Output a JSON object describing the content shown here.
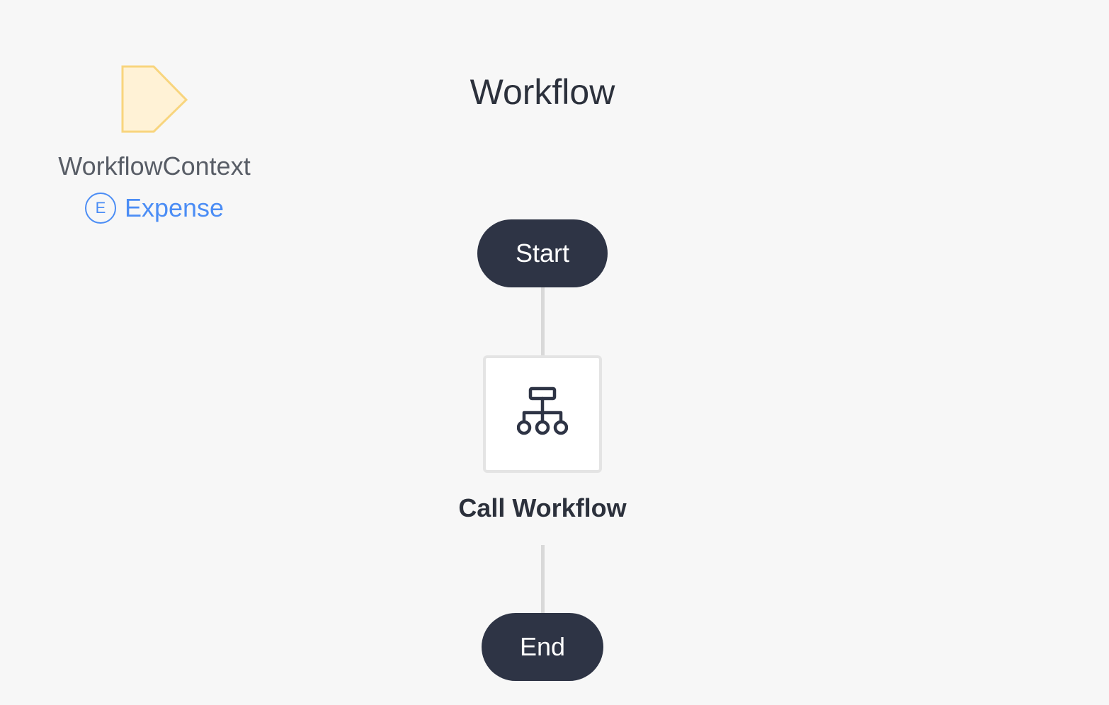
{
  "context_parameter": {
    "name": "WorkflowContext",
    "entity_badge": "E",
    "type_name": "Expense",
    "shape_icon": "pentagon-arrow-icon",
    "shape_fill": "#fff2d6",
    "shape_stroke": "#f8d57e"
  },
  "flow": {
    "title": "Workflow",
    "start_label": "Start",
    "end_label": "End",
    "activity": {
      "label": "Call Workflow",
      "icon": "sitemap-icon"
    }
  },
  "colors": {
    "background": "#f7f7f7",
    "terminal": "#2e3445",
    "link": "#4b8df5",
    "connector": "#d9d9d9"
  }
}
